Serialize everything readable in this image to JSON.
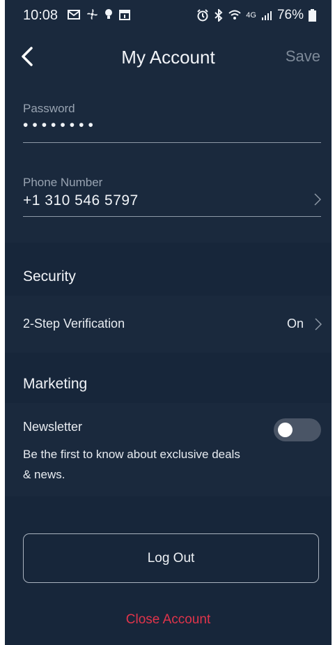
{
  "status_bar": {
    "time": "10:08",
    "left_icons": [
      "mail-icon",
      "fan-icon",
      "bulb-icon",
      "calendar-icon"
    ],
    "right_icons": [
      "alarm-icon",
      "bluetooth-icon",
      "wifi-icon",
      "lte-signal-icon"
    ],
    "network": "4G",
    "battery_percent": "76%"
  },
  "header": {
    "title": "My Account",
    "save_label": "Save"
  },
  "fields": {
    "password": {
      "label": "Password",
      "value": "••••••••"
    },
    "phone": {
      "label": "Phone Number",
      "value": "+1 310 546 5797"
    }
  },
  "security": {
    "heading": "Security",
    "two_step_label": "2-Step Verification",
    "two_step_value": "On"
  },
  "marketing": {
    "heading": "Marketing",
    "newsletter_label": "Newsletter",
    "newsletter_description": "Be the first to know about exclusive deals & news.",
    "newsletter_enabled": false
  },
  "actions": {
    "logout_label": "Log Out",
    "close_account_label": "Close Account"
  },
  "colors": {
    "background": "#17263a",
    "panel": "#1a293d",
    "danger": "#e0344b",
    "muted_text": "#98a3b1"
  }
}
